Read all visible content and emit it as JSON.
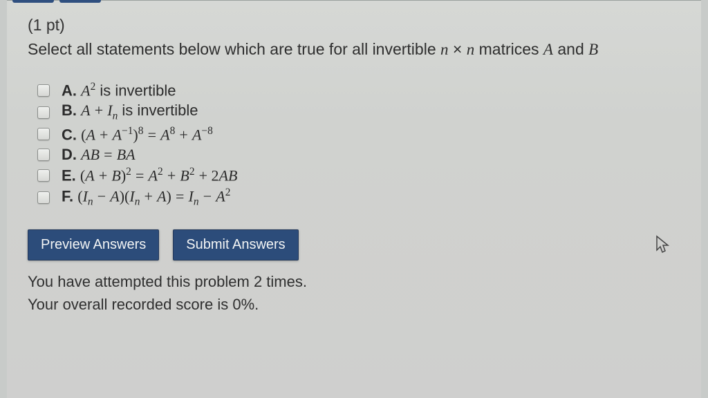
{
  "points": "(1 pt)",
  "prompt_html": "Select all statements below which are true for all invertible <span class='math-i'>n</span> × <span class='math-i'>n</span> matrices <span class='math-i'>A</span> and <span class='math-i'>B</span>",
  "options": [
    {
      "letter": "A.",
      "html": "<span class='mexpr'>A</span><sup class='mup'>2</sup> is invertible"
    },
    {
      "letter": "B.",
      "html": "<span class='mexpr'>A</span> <span class='mup'>+</span> <span class='mexpr'>I</span><sub class='mexpr'>n</sub> is invertible"
    },
    {
      "letter": "C.",
      "html": "<span class='mup'>(</span><span class='mexpr'>A</span> <span class='mup'>+</span> <span class='mexpr'>A</span><sup class='mup'>−1</sup><span class='mup'>)</span><sup class='mup'>8</sup> <span class='mup'>=</span> <span class='mexpr'>A</span><sup class='mup'>8</sup> <span class='mup'>+</span> <span class='mexpr'>A</span><sup class='mup'>−8</sup>"
    },
    {
      "letter": "D.",
      "html": "<span class='mexpr'>AB</span> <span class='mup'>=</span> <span class='mexpr'>BA</span>"
    },
    {
      "letter": "E.",
      "html": "<span class='mup'>(</span><span class='mexpr'>A</span> <span class='mup'>+</span> <span class='mexpr'>B</span><span class='mup'>)</span><sup class='mup'>2</sup> <span class='mup'>=</span> <span class='mexpr'>A</span><sup class='mup'>2</sup> <span class='mup'>+</span> <span class='mexpr'>B</span><sup class='mup'>2</sup> <span class='mup'>+ 2</span><span class='mexpr'>AB</span>"
    },
    {
      "letter": "F.",
      "html": "<span class='mup'>(</span><span class='mexpr'>I</span><sub class='mexpr'>n</sub> <span class='mup'>−</span> <span class='mexpr'>A</span><span class='mup'>)(</span><span class='mexpr'>I</span><sub class='mexpr'>n</sub> <span class='mup'>+</span> <span class='mexpr'>A</span><span class='mup'>)</span> <span class='mup'>=</span> <span class='mexpr'>I</span><sub class='mexpr'>n</sub> <span class='mup'>−</span> <span class='mexpr'>A</span><sup class='mup'>2</sup>"
    }
  ],
  "buttons": {
    "preview": "Preview Answers",
    "submit": "Submit Answers"
  },
  "footer": {
    "attempts": "You have attempted this problem 2 times.",
    "score": "Your overall recorded score is 0%."
  }
}
